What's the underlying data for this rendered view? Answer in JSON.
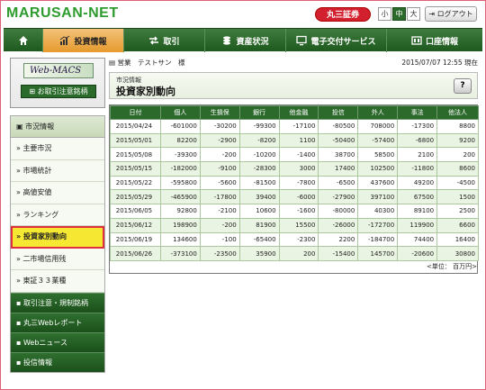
{
  "header": {
    "logo": "MARUSAN-NET",
    "brand": "丸三証券",
    "font_sizes": [
      "小",
      "中",
      "大"
    ],
    "logout": "ログアウト"
  },
  "nav": [
    "投資情報",
    "取引",
    "資産状況",
    "電子交付サービス",
    "口座情報"
  ],
  "sidebar": {
    "banner_title": "Web-MACS",
    "banner_button": "お取引注意銘柄",
    "section": "市況情報",
    "items": [
      "主要市況",
      "市場統計",
      "高値安値",
      "ランキング",
      "投資家別動向",
      "二市場信用残",
      "東証３３業種"
    ],
    "groups": [
      "取引注意・規制銘柄",
      "丸三Webレポート",
      "Webニュース",
      "投信情報"
    ]
  },
  "account": {
    "label": "営業　テストサン　様",
    "datetime": "2015/07/07 12:55 現在"
  },
  "page": {
    "subtitle": "市況情報",
    "title": "投資家別動向",
    "help": "?"
  },
  "table": {
    "headers": [
      "日付",
      "個人",
      "生損保",
      "銀行",
      "他金融",
      "投信",
      "外人",
      "事法",
      "他法人"
    ],
    "rows": [
      [
        "2015/04/24",
        "-601000",
        "-30200",
        "-99300",
        "-17100",
        "-80500",
        "708000",
        "-17300",
        "8800"
      ],
      [
        "2015/05/01",
        "82200",
        "-2900",
        "-8200",
        "1100",
        "-50400",
        "-57400",
        "-6800",
        "9200"
      ],
      [
        "2015/05/08",
        "-39300",
        "-200",
        "-10200",
        "-1400",
        "38700",
        "58500",
        "2100",
        "200"
      ],
      [
        "2015/05/15",
        "-182000",
        "-9100",
        "-28300",
        "3000",
        "17400",
        "102500",
        "-11800",
        "8600"
      ],
      [
        "2015/05/22",
        "-595800",
        "-5600",
        "-81500",
        "-7800",
        "-6500",
        "437600",
        "49200",
        "-4500"
      ],
      [
        "2015/05/29",
        "-465900",
        "-17800",
        "39400",
        "-6000",
        "-27900",
        "397100",
        "67500",
        "1500"
      ],
      [
        "2015/06/05",
        "92800",
        "-2100",
        "10600",
        "-1600",
        "-80000",
        "40300",
        "89100",
        "2500"
      ],
      [
        "2015/06/12",
        "198900",
        "-200",
        "81900",
        "15500",
        "-26000",
        "-172700",
        "119900",
        "6600"
      ],
      [
        "2015/06/19",
        "134600",
        "-100",
        "-65400",
        "-2300",
        "2200",
        "-184700",
        "74400",
        "16400"
      ],
      [
        "2015/06/26",
        "-373100",
        "-23500",
        "35900",
        "200",
        "-15400",
        "145700",
        "-20600",
        "30800"
      ]
    ],
    "unit": "<単位： 百万円>"
  }
}
